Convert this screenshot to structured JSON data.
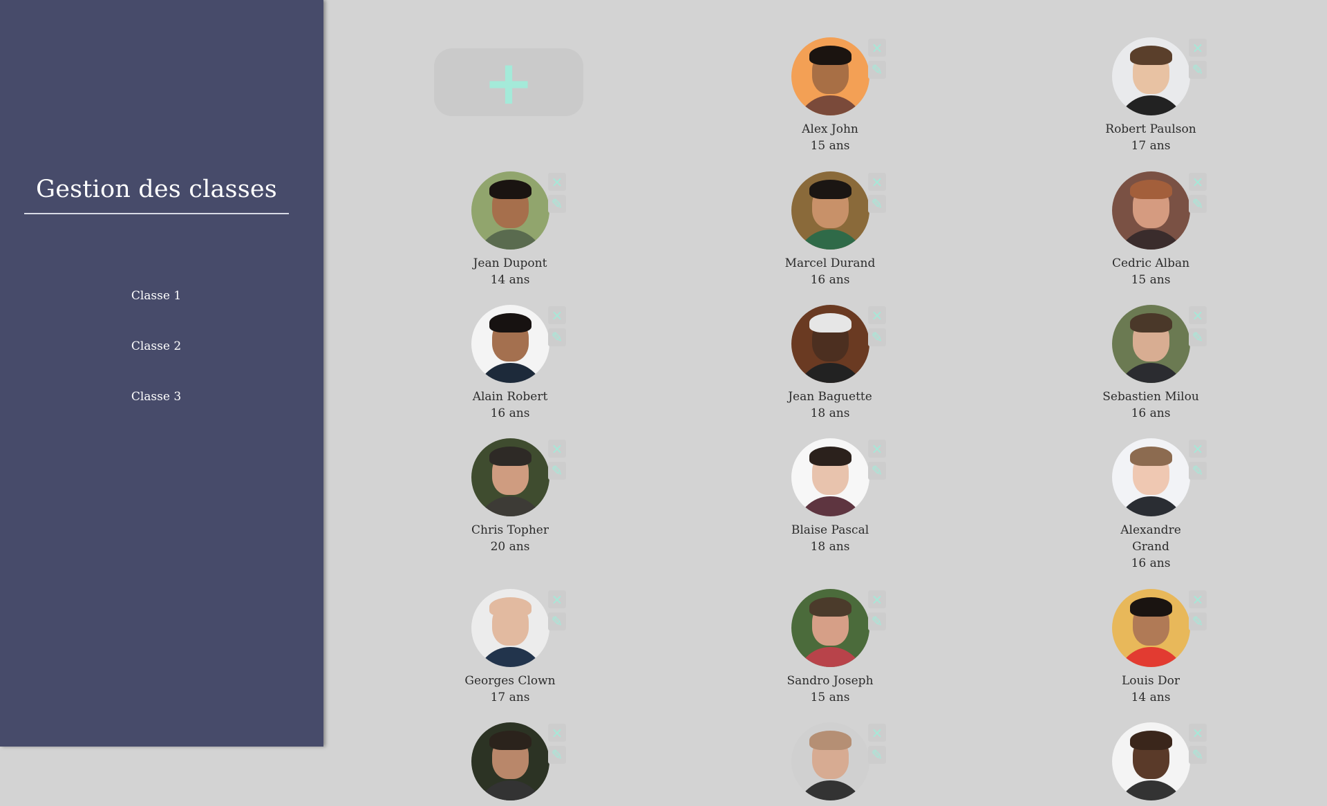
{
  "sidebar": {
    "title": "Gestion des classes",
    "classes": [
      "Classe 1",
      "Classe 2",
      "Classe 3"
    ]
  },
  "main": {
    "add_label": "+",
    "delete_icon": "×",
    "edit_icon": "✎",
    "students": [
      {
        "name": "Alex John",
        "age": "15 ans",
        "skin": "#a86f45",
        "hair": "#1b1410",
        "shirt": "#7a4a3a",
        "bg": "#f3a055"
      },
      {
        "name": "Robert Paulson",
        "age": "17 ans",
        "skin": "#e8c2a3",
        "hair": "#5a3f2b",
        "shirt": "#222222",
        "bg": "#e9eaec"
      },
      {
        "name": "Jean Dupont",
        "age": "14 ans",
        "skin": "#a66f4c",
        "hair": "#1a1411",
        "shirt": "#5a6b4f",
        "bg": "#91a56d"
      },
      {
        "name": "Marcel Durand",
        "age": "16 ans",
        "skin": "#c89169",
        "hair": "#1b1613",
        "shirt": "#2f6a48",
        "bg": "#8a6a3a"
      },
      {
        "name": "Cedric Alban",
        "age": "15 ans",
        "skin": "#d59b80",
        "hair": "#a35f3b",
        "shirt": "#3a2c2c",
        "bg": "#7a5144"
      },
      {
        "name": "Alain Robert",
        "age": "16 ans",
        "skin": "#a4704f",
        "hair": "#171211",
        "shirt": "#1d2a3a",
        "bg": "#f4f4f4"
      },
      {
        "name": "Jean Baguette",
        "age": "18 ans",
        "skin": "#4c2f20",
        "hair": "#e6e6e6",
        "shirt": "#222222",
        "bg": "#6a3a22"
      },
      {
        "name": "Sebastien Milou",
        "age": "16 ans",
        "skin": "#d8ad92",
        "hair": "#4a3829",
        "shirt": "#2b2c30",
        "bg": "#6b7a52"
      },
      {
        "name": "Chris Topher",
        "age": "20 ans",
        "skin": "#cf9c80",
        "hair": "#2e2a26",
        "shirt": "#3d3b36",
        "bg": "#3f4c2f"
      },
      {
        "name": "Blaise Pascal",
        "age": "18 ans",
        "skin": "#e8c3ad",
        "hair": "#2b211c",
        "shirt": "#5e3540",
        "bg": "#f7f7f7"
      },
      {
        "name": "Alexandre Grand",
        "age": "16 ans",
        "skin": "#efc8b2",
        "hair": "#8c6b50",
        "shirt": "#2a2d33",
        "bg": "#f2f3f6"
      },
      {
        "name": "Georges Clown",
        "age": "17 ans",
        "skin": "#e2baa0",
        "hair": "#e2baa0",
        "shirt": "#22344c",
        "bg": "#ececec"
      },
      {
        "name": "Sandro Joseph",
        "age": "15 ans",
        "skin": "#d69f87",
        "hair": "#4b3b2b",
        "shirt": "#b8434a",
        "bg": "#4b6b3b"
      },
      {
        "name": "Louis Dor",
        "age": "14 ans",
        "skin": "#b07a56",
        "hair": "#1a1411",
        "shirt": "#e23b31",
        "bg": "#e8b85a"
      }
    ],
    "partial_row": [
      {
        "skin": "#b9876a",
        "hair": "#2b231c",
        "bg": "#2c3324"
      },
      {
        "skin": "#d7ab92",
        "hair": "#b58f74",
        "bg": "#d0d0d0"
      },
      {
        "skin": "#5a3a29",
        "hair": "#3a261b",
        "bg": "#f4f4f4"
      }
    ]
  }
}
